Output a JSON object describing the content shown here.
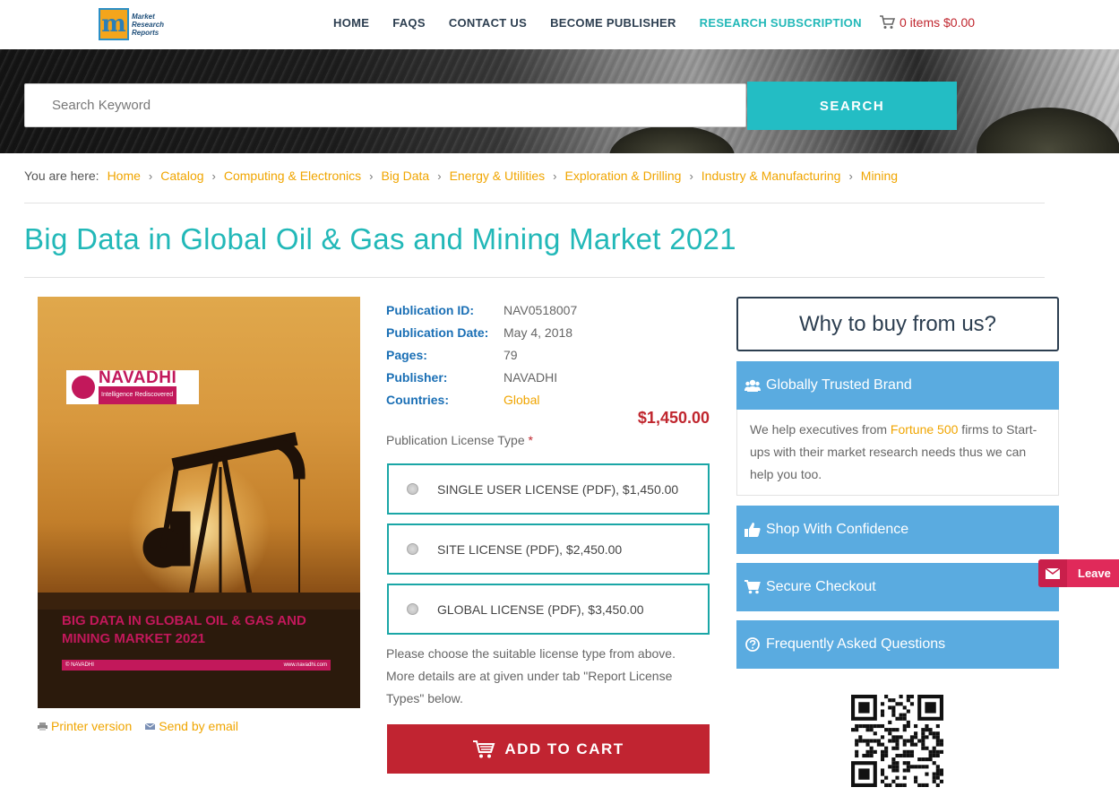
{
  "header": {
    "logo_text": "Market Research Reports",
    "logo_letter": "m",
    "nav": [
      {
        "label": "HOME"
      },
      {
        "label": "FAQS"
      },
      {
        "label": "CONTACT US"
      },
      {
        "label": "BECOME PUBLISHER"
      },
      {
        "label": "RESEARCH SUBSCRIPTION"
      }
    ],
    "cart_label": "0 items $0.00",
    "cart_icon": "cart-icon"
  },
  "search": {
    "placeholder": "Search Keyword",
    "value": "",
    "button_label": "SEARCH"
  },
  "breadcrumb": {
    "lead": "You are here:",
    "items": [
      "Home",
      "Catalog",
      "Computing & Electronics",
      "Big Data",
      "Energy & Utilities",
      "Exploration & Drilling",
      "Industry & Manufacturing",
      "Mining"
    ]
  },
  "page_title": "Big Data in Global Oil & Gas and Mining Market 2021",
  "cover": {
    "publisher_logo": "NAVADHI",
    "publisher_tagline": "Intelligence Rediscovered",
    "cover_title_line1": "BIG DATA IN GLOBAL OIL & GAS AND",
    "cover_title_line2": "MINING MARKET 2021",
    "strip_left": "© NAVADHI",
    "strip_right": "www.navadhi.com"
  },
  "cover_links": {
    "printer": "Printer version",
    "email": "Send by email"
  },
  "meta": {
    "pub_id_label": "Publication ID:",
    "pub_id": "NAV0518007",
    "pub_date_label": "Publication Date:",
    "pub_date": "May 4, 2018",
    "pages_label": "Pages:",
    "pages": "79",
    "publisher_label": "Publisher:",
    "publisher": "NAVADHI",
    "countries_label": "Countries:",
    "countries": "Global"
  },
  "price": "$1,450.00",
  "license": {
    "label": "Publication License Type",
    "required_mark": "*",
    "options": [
      {
        "label": "SINGLE USER LICENSE (PDF), $1,450.00"
      },
      {
        "label": "SITE LICENSE (PDF), $2,450.00"
      },
      {
        "label": "GLOBAL LICENSE (PDF), $3,450.00"
      }
    ],
    "note": "Please choose the suitable license type from above. More details are at given under tab \"Report License Types\" below."
  },
  "add_to_cart": "ADD TO CART",
  "sidebar": {
    "why_title": "Why to buy from us?",
    "sections": [
      {
        "label": "Globally Trusted Brand",
        "icon": "users-icon"
      },
      {
        "label": "Shop With Confidence",
        "icon": "thumbs-up-icon"
      },
      {
        "label": "Secure Checkout",
        "icon": "cart-icon"
      },
      {
        "label": "Frequently Asked Questions",
        "icon": "question-circle-icon"
      }
    ],
    "body_pre": "We help executives from ",
    "body_hl": "Fortune 500",
    "body_post": " firms to Start-ups with their market research needs thus we can help you too."
  },
  "leave_label": "Leave",
  "colors": {
    "teal": "#22b8b8",
    "accent_orange": "#f0a500",
    "cart_red": "#c12431",
    "sidebar_blue": "#5aabe0"
  }
}
